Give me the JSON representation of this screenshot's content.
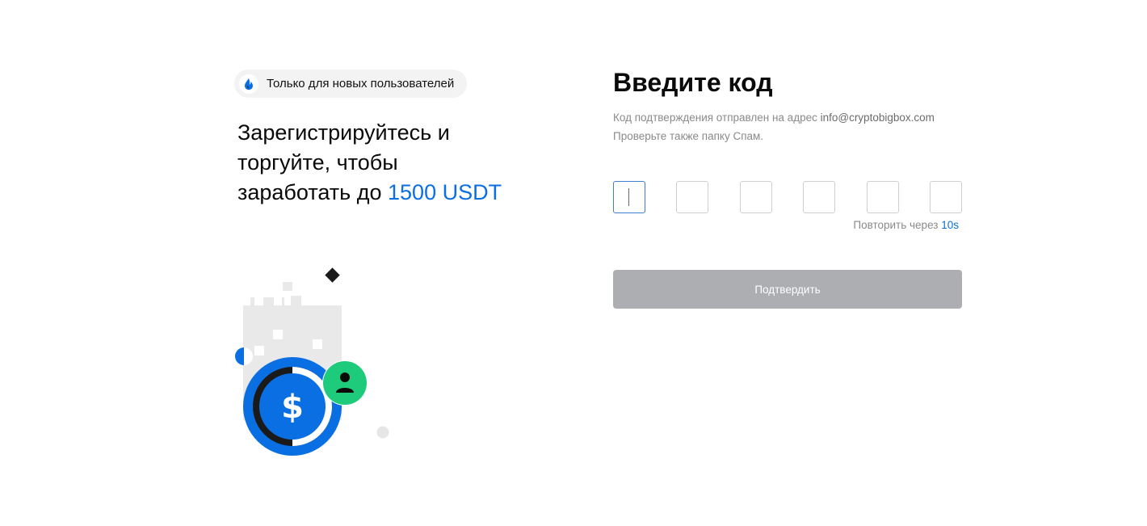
{
  "promo": {
    "badge_text": "Только для новых пользователей",
    "headline_line1": "Зарегистрируйтесь и",
    "headline_line2": "торгуйте, чтобы",
    "headline_line3_prefix": "заработать до ",
    "headline_amount": "1500 USDT"
  },
  "form": {
    "title": "Введите код",
    "subtitle_prefix": "Код подтверждения отправлен на адрес ",
    "email": "info@cryptobigbox.com",
    "subtitle_line2": "Проверьте также папку Спам.",
    "code_digits": [
      "",
      "",
      "",
      "",
      "",
      ""
    ],
    "resend_label": "Повторить через ",
    "resend_timer": "10s",
    "confirm_label": "Подтвердить"
  },
  "colors": {
    "accent": "#0a6fe3",
    "button_disabled": "#adaeb2",
    "green": "#1dcb7a",
    "dark": "#1a1a1a"
  },
  "icons": {
    "badge_logo": "drop-logo-icon",
    "illustration": "dollar-coin-user-illustration"
  }
}
